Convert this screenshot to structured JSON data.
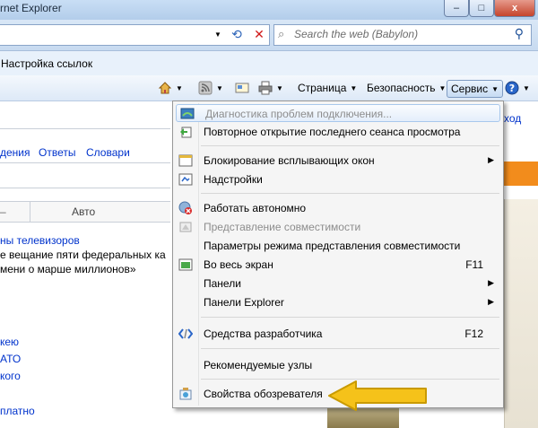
{
  "window": {
    "title": "rnet Explorer",
    "minimize": "–",
    "maximize": "□",
    "close": "x"
  },
  "search": {
    "placeholder": "Search the web (Babylon)"
  },
  "tab": {
    "label": "Настройка ссылок"
  },
  "cmdbar": {
    "page": "Страница",
    "security": "Безопасность",
    "service": "Сервис"
  },
  "content": {
    "exit": "ход",
    "nav": [
      "дения",
      "Ответы",
      "Словари"
    ],
    "table_col": "Авто",
    "news": [
      "ны телевизоров",
      "е вещание пяти федеральных ка",
      "мени о марше миллионов»"
    ],
    "links": [
      "кею",
      "АТО",
      "кого",
      "платно"
    ]
  },
  "menu": {
    "items": [
      {
        "label": "Диагностика проблем подключения...",
        "disabled": true,
        "highlight": true,
        "icon": "network-diagnose-icon"
      },
      {
        "label": "Повторное открытие последнего сеанса просмотра",
        "icon": "reopen-session-icon"
      },
      {
        "label": "Блокирование всплывающих окон",
        "submenu": true,
        "icon": "popup-blocker-icon"
      },
      {
        "label": "Надстройки",
        "icon": "addons-icon"
      },
      {
        "label": "Работать автономно",
        "icon": "offline-icon"
      },
      {
        "label": "Представление совместимости",
        "disabled": true,
        "icon": "compatibility-icon"
      },
      {
        "label": "Параметры режима представления совместимости"
      },
      {
        "label": "Во весь экран",
        "shortcut": "F11",
        "icon": "fullscreen-icon"
      },
      {
        "label": "Панели",
        "submenu": true
      },
      {
        "label": "Панели Explorer",
        "submenu": true
      },
      {
        "label": "Средства разработчика",
        "shortcut": "F12",
        "icon": "developer-tools-icon"
      },
      {
        "label": "Рекомендуемые узлы"
      },
      {
        "label": "Свойства обозревателя",
        "icon": "internet-options-icon"
      }
    ]
  },
  "colors": {
    "accent_arrow": "#f5c21a",
    "link": "#0033cc",
    "orange_block": "#f28c1c"
  }
}
